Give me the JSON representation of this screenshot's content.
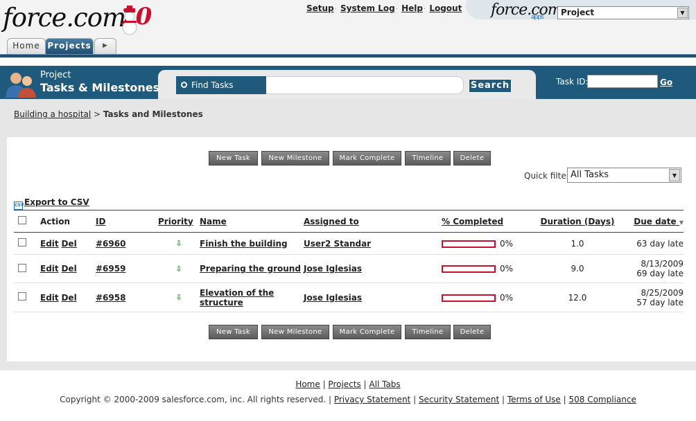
{
  "header": {
    "logo_text": "force.com",
    "logo_suffix": "10",
    "links": [
      "Setup",
      "System Log",
      "Help",
      "Logout"
    ],
    "app_logo": "force.com",
    "app_logo_sub": "apps",
    "app_select": "Project"
  },
  "tabs": [
    "Home",
    "Projects",
    "▶"
  ],
  "page": {
    "title_small": "Project",
    "title_big": "Tasks & Milestones"
  },
  "search": {
    "find_label": "Find Tasks",
    "button": "Search",
    "task_id_label": "Task ID:",
    "go": "Go"
  },
  "breadcrumb": {
    "parent": "Building a hospital",
    "sep": " > ",
    "current": "Tasks and Milestones"
  },
  "buttons": [
    "New Task",
    "New Milestone",
    "Mark Complete",
    "Timeline",
    "Delete"
  ],
  "quick_filter": {
    "label": "Quick filter:",
    "value": "All Tasks"
  },
  "export_label": "Export to CSV",
  "export_icon_text": "CSV",
  "table": {
    "headers": [
      "Action",
      "ID",
      "Priority",
      "Name",
      "Assigned to",
      "% Completed",
      "Duration (Days)",
      "Due date"
    ],
    "rows": [
      {
        "edit": "Edit",
        "del": "Del",
        "id": "#6960",
        "name": "Finish the building",
        "assigned": "User2 Standar",
        "completed": "0%",
        "completed_value": 0,
        "duration": "1.0",
        "due1": "",
        "due2": "63 day late"
      },
      {
        "edit": "Edit",
        "del": "Del",
        "id": "#6959",
        "name": "Preparing the ground",
        "assigned": "Jose Iglesias",
        "completed": "0%",
        "completed_value": 0,
        "duration": "9.0",
        "due1": "8/13/2009",
        "due2": "69 day late"
      },
      {
        "edit": "Edit",
        "del": "Del",
        "id": "#6958",
        "name": "Elevation of the structure",
        "assigned": "Jose Iglesias",
        "completed": "0%",
        "completed_value": 0,
        "duration": "12.0",
        "due1": "8/25/2009",
        "due2": "57 day late"
      }
    ]
  },
  "footer": {
    "links": [
      "Home",
      "Projects",
      "All Tabs"
    ],
    "copyright": "Copyright © 2000-2009 salesforce.com, inc. All rights reserved.",
    "legal": [
      "Privacy Statement",
      "Security Statement",
      "Terms of Use",
      "508 Compliance"
    ]
  },
  "colors": {
    "brand_blue": "#1f5a7c",
    "accent_red": "#c8102e",
    "priority_green": "#2e8b2e"
  },
  "icons": {
    "priority": "arrow-down-icon",
    "search": "search-icon",
    "people": "people-icon",
    "export": "csv-icon"
  }
}
